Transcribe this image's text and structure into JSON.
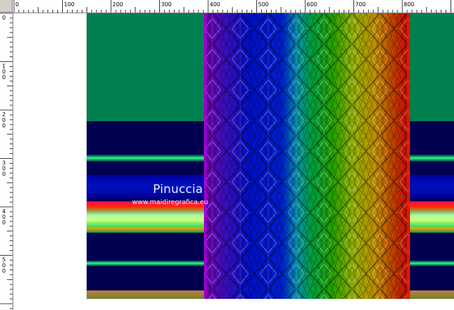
{
  "ruler_top": {
    "labels": [
      "0",
      "100",
      "200",
      "300",
      "400",
      "500",
      "600",
      "700",
      "800"
    ]
  },
  "ruler_left": {
    "labels": [
      "0",
      "100",
      "200",
      "300",
      "400",
      "500"
    ]
  },
  "watermark": {
    "name": "Pinuccia",
    "url": "www.maidiregrafica.eu"
  },
  "colors": {
    "green_top": "#008050",
    "navy": "#000050",
    "blue": "#0000a8",
    "bright_green": "#00ff60",
    "workspace": "#d4d0c8"
  },
  "pattern": {
    "hues": [
      "#7a00b0",
      "#0010d0",
      "#0080b0",
      "#00a020",
      "#80b000",
      "#c08000",
      "#d00000"
    ]
  }
}
